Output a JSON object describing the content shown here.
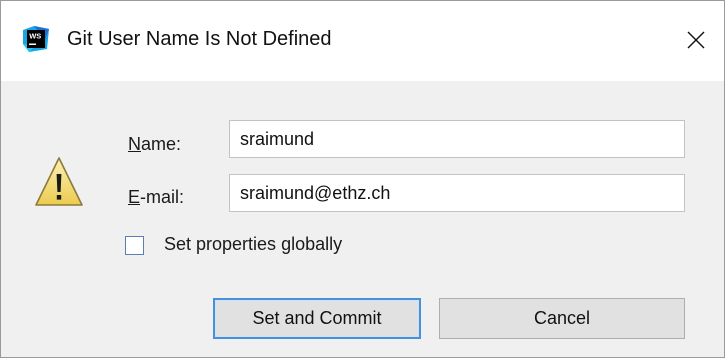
{
  "window": {
    "title": "Git User Name Is Not Defined",
    "app_icon": "webstorm-icon",
    "close_icon": "close-icon"
  },
  "form": {
    "warning_icon": "warning-icon",
    "name": {
      "label_mnemonic": "N",
      "label_rest": "ame:",
      "value": "sraimund"
    },
    "email": {
      "label_mnemonic": "E",
      "label_rest": "-mail:",
      "value": "sraimund@ethz.ch"
    },
    "global": {
      "label_before": "Set properties ",
      "label_mnemonic": "g",
      "label_after": "lobally",
      "checked": false
    }
  },
  "buttons": {
    "primary": "Set and Commit",
    "secondary": "Cancel"
  },
  "colors": {
    "dialog_bg": "#f0f0f0",
    "title_bg": "#ffffff",
    "focus_border": "#4a8fd9",
    "warning_fill": "#f6e58b"
  }
}
